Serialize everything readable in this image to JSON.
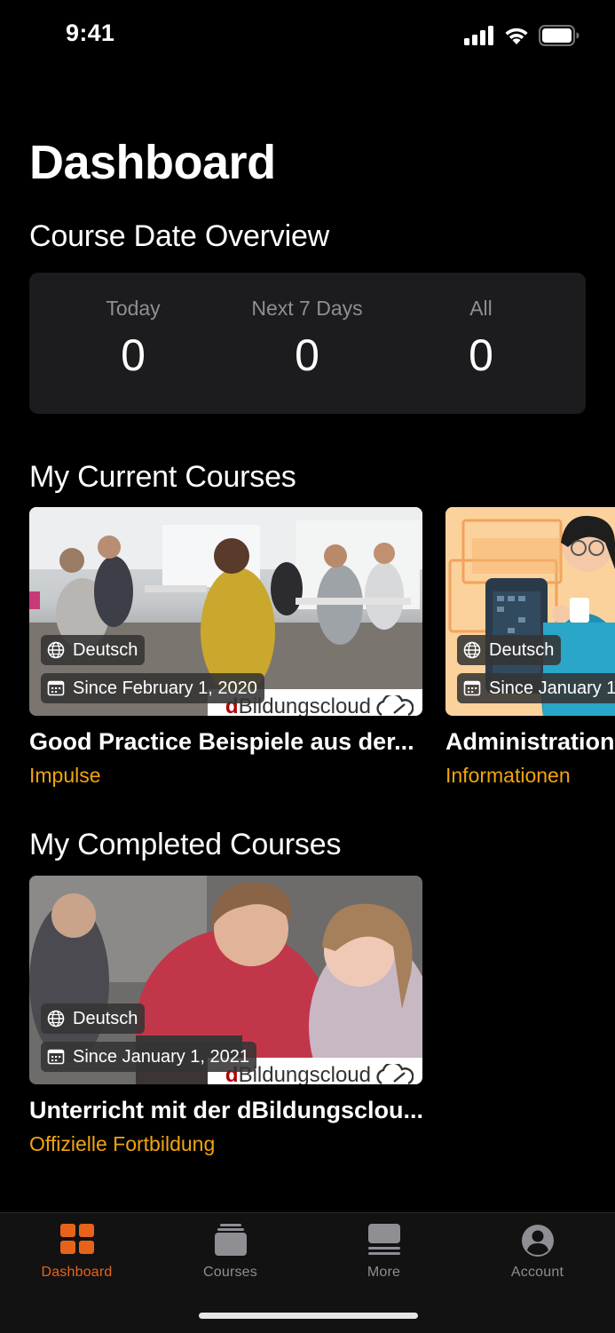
{
  "status_bar": {
    "time": "9:41"
  },
  "page": {
    "title": "Dashboard"
  },
  "overview": {
    "heading": "Course Date Overview",
    "stats": [
      {
        "label": "Today",
        "value": "0"
      },
      {
        "label": "Next 7 Days",
        "value": "0"
      },
      {
        "label": "All",
        "value": "0"
      }
    ]
  },
  "current_courses": {
    "heading": "My Current Courses",
    "items": [
      {
        "language": "Deutsch",
        "since": "Since February 1, 2020",
        "title": "Good Practice Beispiele aus der...",
        "category": "Impulse",
        "logo": "dBildungscloud"
      },
      {
        "language": "Deutsch",
        "since": "Since January 1",
        "title": "Administration",
        "category": "Informationen"
      }
    ]
  },
  "completed_courses": {
    "heading": "My Completed Courses",
    "items": [
      {
        "language": "Deutsch",
        "since": "Since January 1, 2021",
        "title": "Unterricht mit der dBildungsclou...",
        "category": "Offizielle Fortbildung",
        "logo": "dBildungscloud"
      }
    ]
  },
  "tabbar": {
    "items": [
      {
        "label": "Dashboard",
        "icon": "dashboard-grid-icon",
        "active": true
      },
      {
        "label": "Courses",
        "icon": "courses-stack-icon",
        "active": false
      },
      {
        "label": "More",
        "icon": "more-list-icon",
        "active": false
      },
      {
        "label": "Account",
        "icon": "account-person-icon",
        "active": false
      }
    ]
  },
  "colors": {
    "accent": "#e8631a",
    "category": "#f2a40f",
    "card_bg": "#1c1c1e",
    "background": "#000000"
  }
}
